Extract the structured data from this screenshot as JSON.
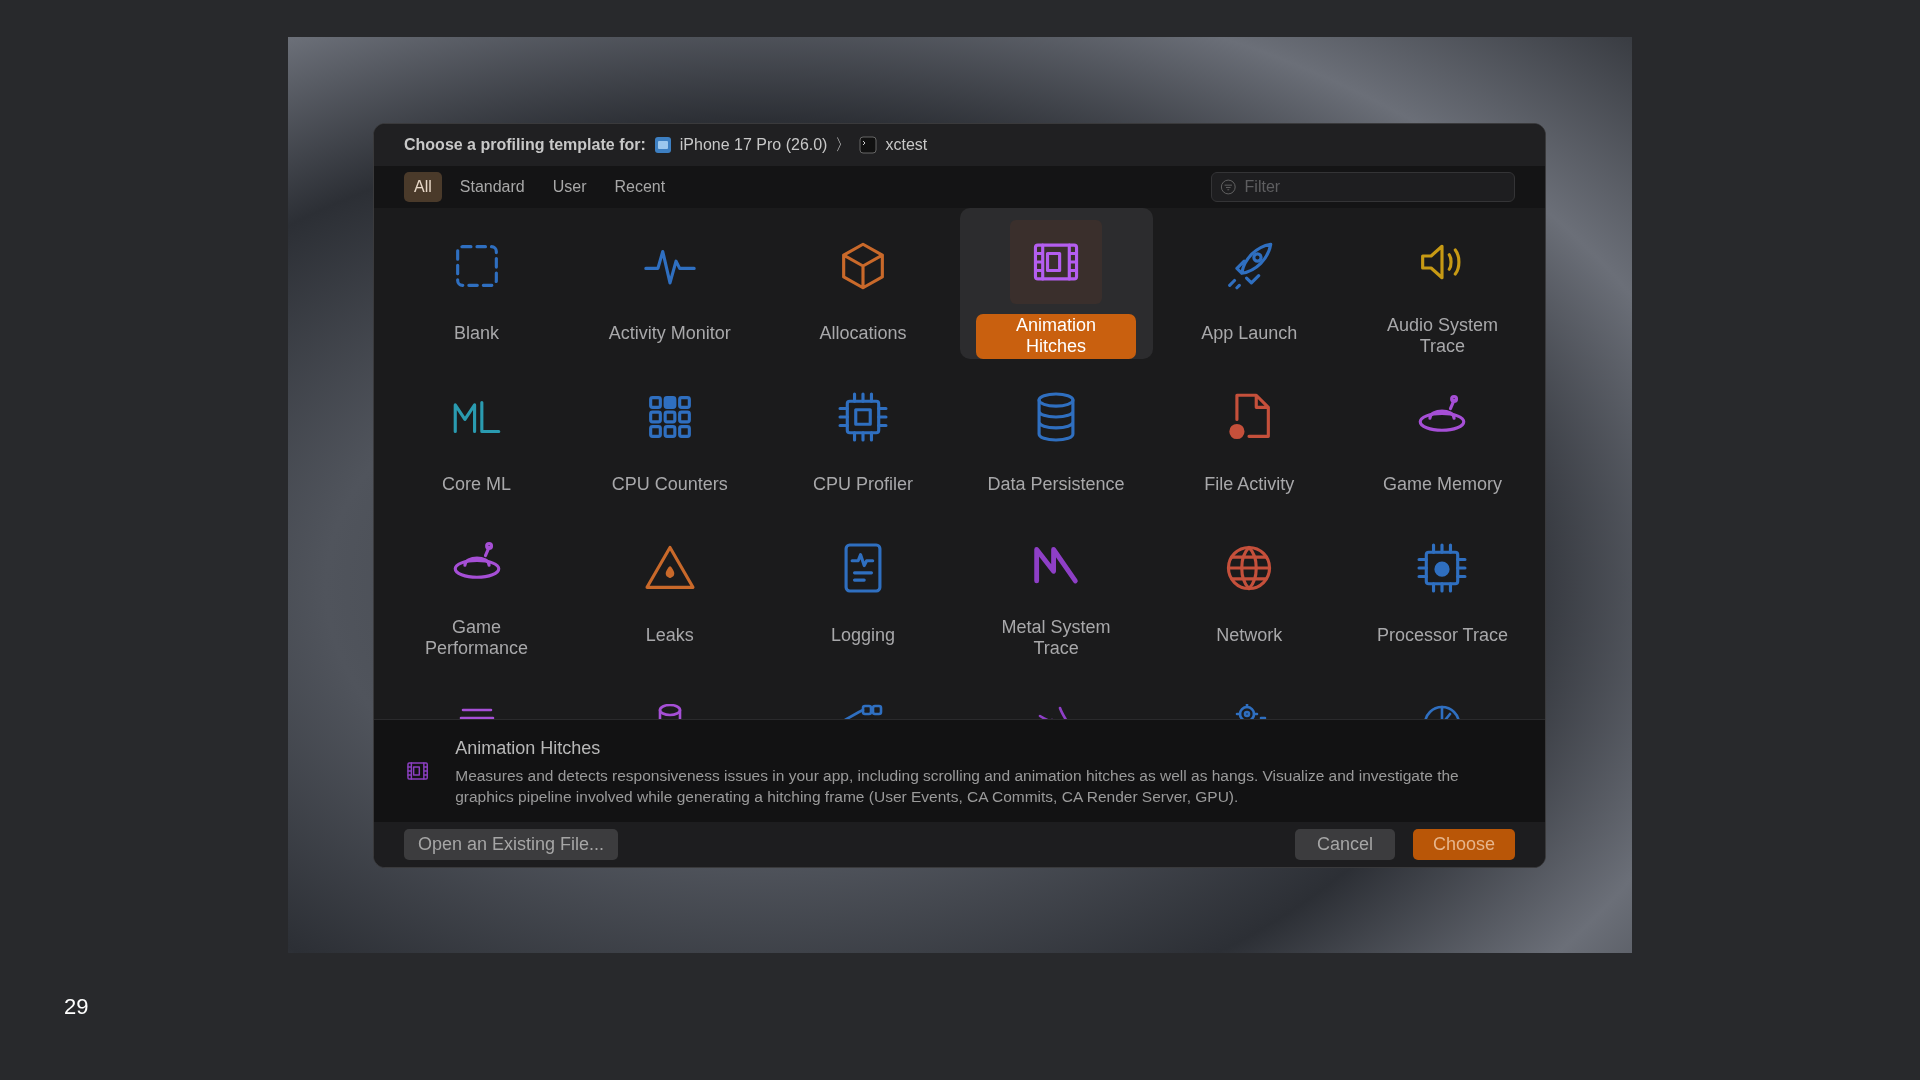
{
  "slide_number": "29",
  "dialog": {
    "prompt": "Choose a profiling template for:",
    "device": "iPhone 17 Pro (26.0)",
    "separator": "〉",
    "target": "xctest",
    "tabs": [
      {
        "label": "All",
        "selected": true
      },
      {
        "label": "Standard",
        "selected": false
      },
      {
        "label": "User",
        "selected": false
      },
      {
        "label": "Recent",
        "selected": false
      }
    ],
    "filter": {
      "placeholder": "Filter"
    },
    "templates": [
      {
        "label": "Blank",
        "selected": false
      },
      {
        "label": "Activity Monitor",
        "selected": false
      },
      {
        "label": "Allocations",
        "selected": false
      },
      {
        "label": "Animation Hitches",
        "selected": true
      },
      {
        "label": "App Launch",
        "selected": false
      },
      {
        "label": "Audio System Trace",
        "selected": false
      },
      {
        "label": "Core ML",
        "selected": false
      },
      {
        "label": "CPU Counters",
        "selected": false
      },
      {
        "label": "CPU Profiler",
        "selected": false
      },
      {
        "label": "Data Persistence",
        "selected": false
      },
      {
        "label": "File Activity",
        "selected": false
      },
      {
        "label": "Game Memory",
        "selected": false
      },
      {
        "label": "Game Performance",
        "selected": false
      },
      {
        "label": "Leaks",
        "selected": false
      },
      {
        "label": "Logging",
        "selected": false
      },
      {
        "label": "Metal System Trace",
        "selected": false
      },
      {
        "label": "Network",
        "selected": false
      },
      {
        "label": "Processor Trace",
        "selected": false
      }
    ],
    "description": {
      "title": "Animation Hitches",
      "text": "Measures and detects responsiveness issues in your app, including scrolling and animation hitches as well as hangs. Visualize and investigate the graphics pipeline involved while generating a hitching frame (User Events, CA Commits, CA Render Server, GPU)."
    },
    "buttons": {
      "open": "Open an Existing File...",
      "cancel": "Cancel",
      "choose": "Choose"
    }
  }
}
